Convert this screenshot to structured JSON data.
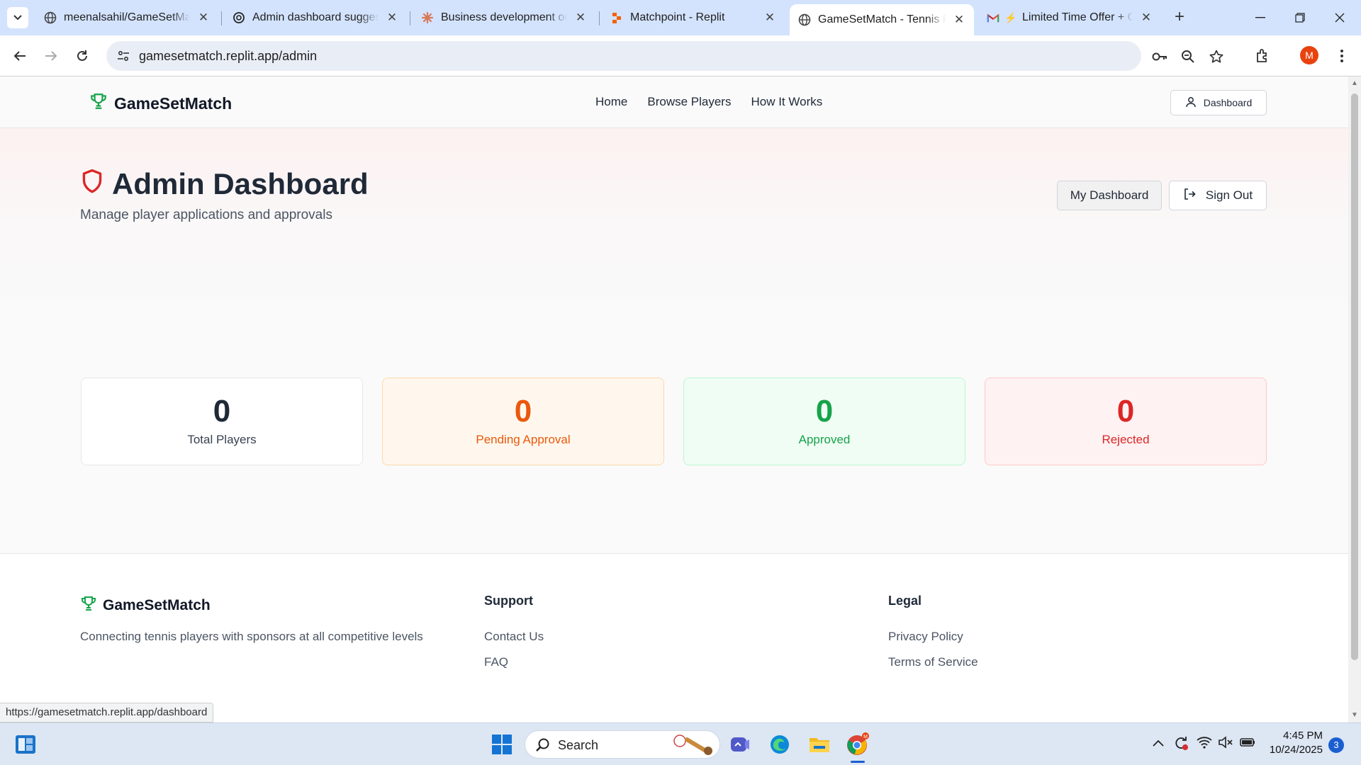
{
  "browser": {
    "tabs": [
      {
        "title": "meenalsahil/GameSetMatc",
        "icon": "globe-icon",
        "active": false
      },
      {
        "title": "Admin dashboard suggest",
        "icon": "openai-icon",
        "active": false
      },
      {
        "title": "Business development out",
        "icon": "claude-icon",
        "active": false
      },
      {
        "title": "Matchpoint - Replit",
        "icon": "replit-icon",
        "active": false
      },
      {
        "title": "GameSetMatch - Tennis Pl",
        "icon": "globe-icon",
        "active": true
      },
      {
        "title": "Limited Time Offer + C",
        "icon": "gmail-icon",
        "active": false
      }
    ],
    "url": "gamesetmatch.replit.app/admin",
    "profile_initial": "M",
    "status_url": "https://gamesetmatch.replit.app/dashboard"
  },
  "site": {
    "brand": "GameSetMatch",
    "nav": [
      "Home",
      "Browse Players",
      "How It Works"
    ],
    "dashboard_button": "Dashboard"
  },
  "admin": {
    "title": "Admin Dashboard",
    "subtitle": "Manage player applications and approvals",
    "my_dashboard": "My Dashboard",
    "sign_out": "Sign Out"
  },
  "stats": [
    {
      "value": "0",
      "label": "Total Players",
      "color": "#1f2937",
      "label_color": "#374151",
      "bg": "#ffffff",
      "border": "#e5e7eb"
    },
    {
      "value": "0",
      "label": "Pending Approval",
      "color": "#ea580c",
      "label_color": "#ea580c",
      "bg": "#fff7ed",
      "border": "#fed7aa"
    },
    {
      "value": "0",
      "label": "Approved",
      "color": "#16a34a",
      "label_color": "#16a34a",
      "bg": "#f0fdf4",
      "border": "#bbf7d0"
    },
    {
      "value": "0",
      "label": "Rejected",
      "color": "#dc2626",
      "label_color": "#dc2626",
      "bg": "#fef2f2",
      "border": "#fecaca"
    }
  ],
  "footer": {
    "brand": "GameSetMatch",
    "description": "Connecting tennis players with sponsors at all competitive levels",
    "support_heading": "Support",
    "support_links": [
      "Contact Us",
      "FAQ"
    ],
    "legal_heading": "Legal",
    "legal_links": [
      "Privacy Policy",
      "Terms of Service"
    ]
  },
  "taskbar": {
    "search_label": "Search",
    "time": "4:45 PM",
    "date": "10/24/2025",
    "notification_count": "3"
  },
  "colors": {
    "brand_green": "#16a34a",
    "shield_red": "#dc2626"
  }
}
